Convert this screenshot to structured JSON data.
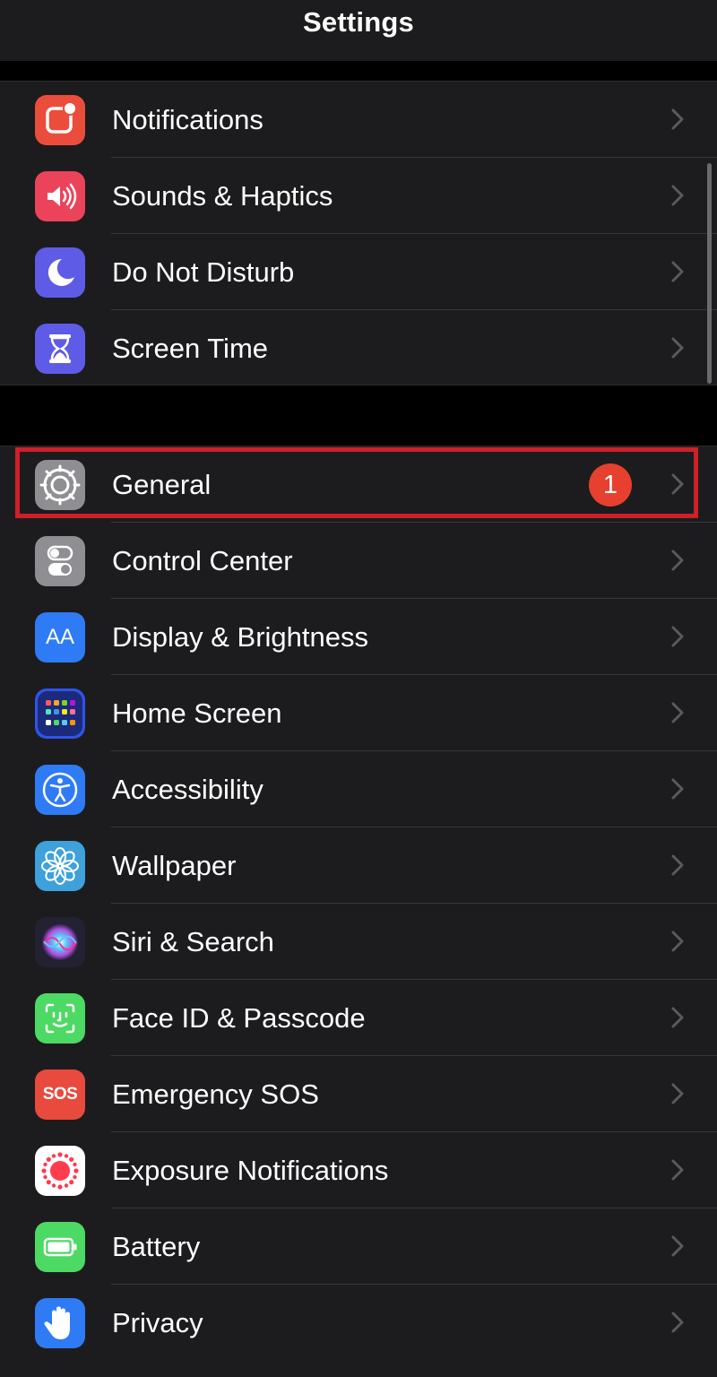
{
  "header": {
    "title": "Settings"
  },
  "colors": {
    "background": "#000000",
    "group_background": "#1c1c1e",
    "highlight": "#cf1f28",
    "badge": "#e8402e"
  },
  "group1": [
    {
      "label": "Notifications",
      "icon": "notifications-icon",
      "color": "#eb4d3d"
    },
    {
      "label": "Sounds & Haptics",
      "icon": "speaker-icon",
      "color": "#eb445a"
    },
    {
      "label": "Do Not Disturb",
      "icon": "moon-icon",
      "color": "#5e5ce6"
    },
    {
      "label": "Screen Time",
      "icon": "hourglass-icon",
      "color": "#5e5ce6"
    }
  ],
  "group2": [
    {
      "label": "General",
      "icon": "gear-icon",
      "color": "#8e8e93",
      "badge": "1"
    },
    {
      "label": "Control Center",
      "icon": "toggles-icon",
      "color": "#8e8e93"
    },
    {
      "label": "Display & Brightness",
      "icon": "text-size-icon",
      "icon_text": "AA",
      "color": "#2f7bf5"
    },
    {
      "label": "Home Screen",
      "icon": "app-grid-icon",
      "color": "#2f54eb"
    },
    {
      "label": "Accessibility",
      "icon": "accessibility-icon",
      "color": "#2f7bf5"
    },
    {
      "label": "Wallpaper",
      "icon": "flower-icon",
      "color": "#3ea1dc"
    },
    {
      "label": "Siri & Search",
      "icon": "siri-icon",
      "color": "#222233"
    },
    {
      "label": "Face ID & Passcode",
      "icon": "face-id-icon",
      "color": "#4cd964"
    },
    {
      "label": "Emergency SOS",
      "icon": "sos-icon",
      "icon_text": "SOS",
      "color": "#e84a3d"
    },
    {
      "label": "Exposure Notifications",
      "icon": "exposure-icon",
      "color": "#ffffff"
    },
    {
      "label": "Battery",
      "icon": "battery-icon",
      "color": "#4cd964"
    },
    {
      "label": "Privacy",
      "icon": "hand-icon",
      "color": "#2f7bf5"
    }
  ]
}
